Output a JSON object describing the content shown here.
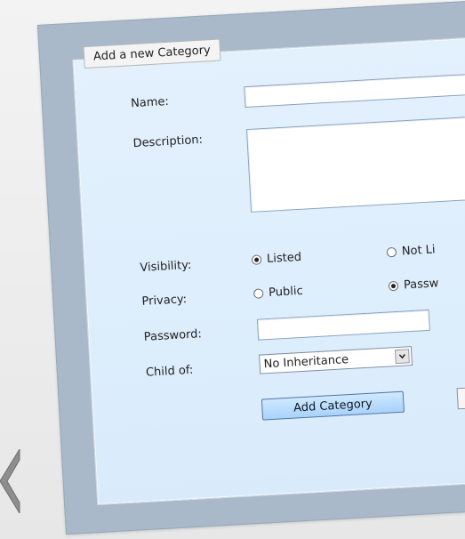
{
  "form": {
    "tab_title": "Add a new Category",
    "name_label": "Name:",
    "description_label": "Description:",
    "visibility_label": "Visibility:",
    "privacy_label": "Privacy:",
    "password_label": "Password:",
    "child_of_label": "Child of:",
    "visibility_options": [
      "Listed",
      "Not Li"
    ],
    "visibility_selected": "Listed",
    "privacy_options": [
      "Public",
      "Passw"
    ],
    "privacy_selected": "Passw",
    "child_of_value": "No Inheritance",
    "submit_label": "Add Category",
    "name_value": "",
    "description_value": "",
    "password_value": ""
  },
  "icons": {
    "left_decoration": "arrow-shape-icon",
    "select_dropdown": "chevron-down-icon"
  }
}
